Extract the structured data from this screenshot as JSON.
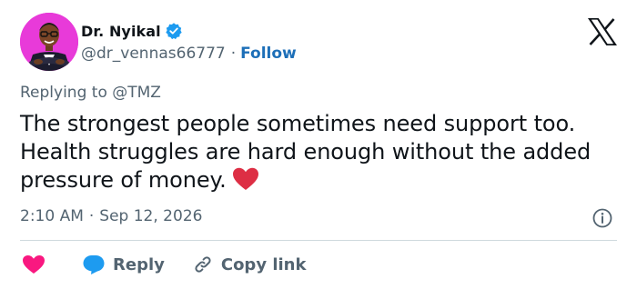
{
  "author": {
    "display_name": "Dr. Nyikal",
    "handle": "@dr_vennas66777",
    "separator": "·",
    "follow_label": "Follow"
  },
  "tweet": {
    "replying_to": "Replying to @TMZ",
    "text": "The strongest people sometimes need support too. Health struggles are hard enough without the added pressure of money.",
    "emoji": "heart-emoji",
    "time": "2:10 AM",
    "separator": "·",
    "date": "Sep 12, 2026"
  },
  "actions": {
    "reply_label": "Reply",
    "copy_link_label": "Copy link"
  },
  "colors": {
    "text": "#0f1419",
    "muted": "#536471",
    "link": "#1d6fb8",
    "heart": "#f91880",
    "reply_bubble": "#1d9bf0",
    "verified": "#1d9bf0",
    "divider": "#cfd9de",
    "avatar_bg": "#e83ad9"
  },
  "icons": [
    "verified-badge-icon",
    "x-logo-icon",
    "heart-icon",
    "reply-bubble-icon",
    "link-icon",
    "info-icon"
  ]
}
